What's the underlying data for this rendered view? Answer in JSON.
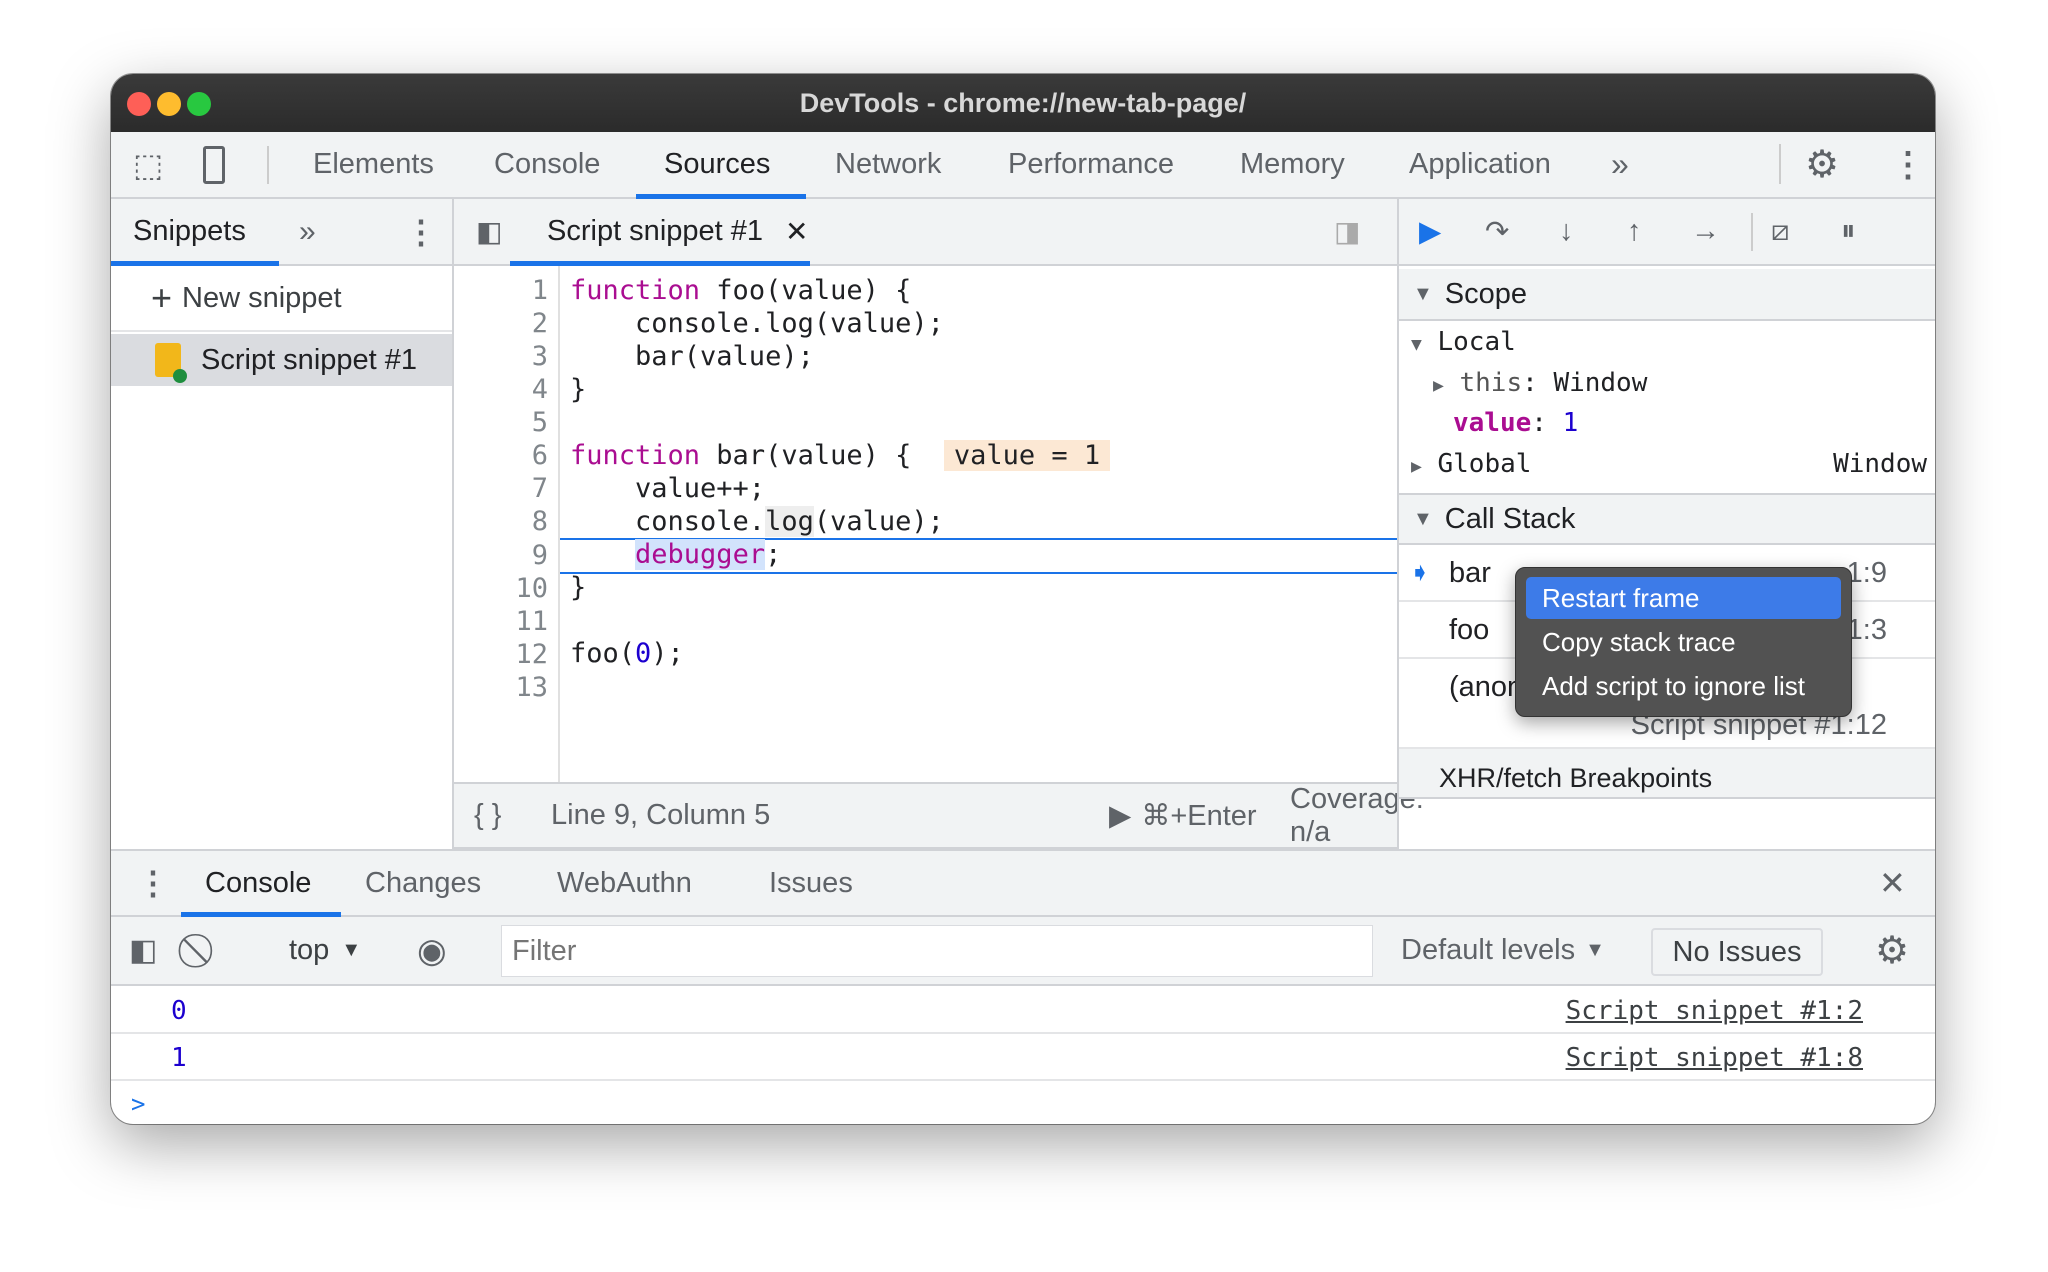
{
  "window": {
    "title": "DevTools - chrome://new-tab-page/"
  },
  "main_tabs": [
    "Elements",
    "Console",
    "Sources",
    "Network",
    "Performance",
    "Memory",
    "Application"
  ],
  "navigator": {
    "tab": "Snippets",
    "new_snippet": "New snippet",
    "items": [
      "Script snippet #1"
    ]
  },
  "editor": {
    "tab": "Script snippet #1",
    "inline_value": "value = 1",
    "lines": [
      "1",
      "2",
      "3",
      "4",
      "5",
      "6",
      "7",
      "8",
      "9",
      "10",
      "11",
      "12",
      "13"
    ],
    "status": {
      "position": "Line 9, Column 5",
      "run": "⌘+Enter",
      "coverage": "Coverage: n/a"
    }
  },
  "scope": {
    "title": "Scope",
    "local": "Local",
    "this_key": "this",
    "this_val": "Window",
    "value_key": "value",
    "value_val": "1",
    "global": "Global",
    "global_val": "Window"
  },
  "call_stack": {
    "title": "Call Stack",
    "frames": [
      {
        "name": "bar",
        "loc": "1:9"
      },
      {
        "name": "foo",
        "loc": "1:3"
      },
      {
        "name": "(anon",
        "loc": "Script snippet #1:12"
      }
    ]
  },
  "xhr": "XHR/fetch Breakpoints",
  "context_menu": [
    "Restart frame",
    "Copy stack trace",
    "Add script to ignore list"
  ],
  "drawer": {
    "tabs": [
      "Console",
      "Changes",
      "WebAuthn",
      "Issues"
    ],
    "context": "top",
    "filter_placeholder": "Filter",
    "levels": "Default levels",
    "issues": "No Issues",
    "messages": [
      {
        "value": "0",
        "source": "Script snippet #1:2"
      },
      {
        "value": "1",
        "source": "Script snippet #1:8"
      }
    ],
    "prompt": ">"
  },
  "colors": {
    "accent": "#1a73e8",
    "keyword": "#aa0d91",
    "number": "#1c00cf",
    "menu_bg": "#525252",
    "menu_highlight": "#3d7be8"
  }
}
